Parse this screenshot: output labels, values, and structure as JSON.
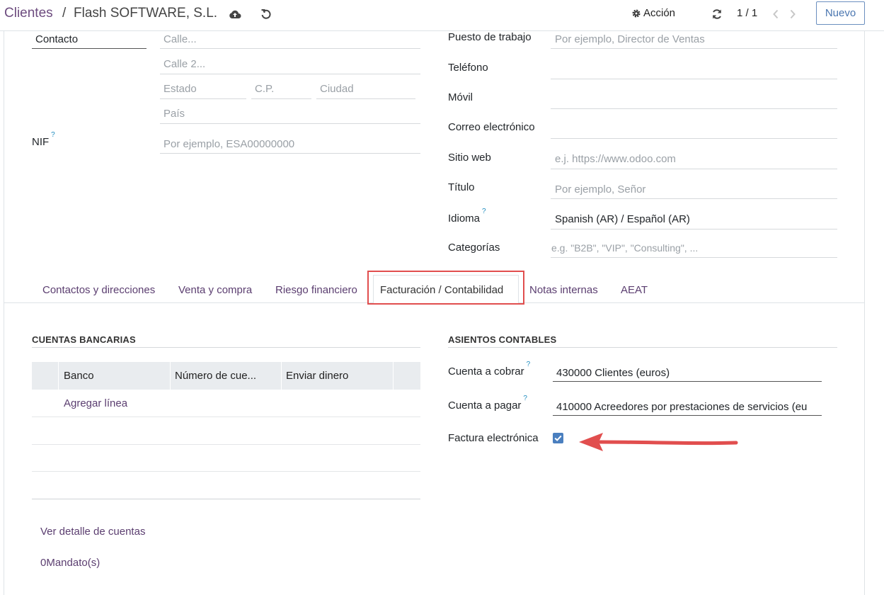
{
  "breadcrumb": {
    "root": "Clientes",
    "separator": "/",
    "current": "Flash SOFTWARE, S.L."
  },
  "toolbar": {
    "action_label": "Acción",
    "pager": "1 / 1",
    "new_label": "Nuevo"
  },
  "address": {
    "type_value": "Contacto",
    "street_placeholder": "Calle...",
    "street2_placeholder": "Calle 2...",
    "state_placeholder": "Estado",
    "zip_placeholder": "C.P.",
    "city_placeholder": "Ciudad",
    "country_placeholder": "País",
    "vat_label": "NIF",
    "vat_help": "?",
    "vat_placeholder": "Por ejemplo, ESA00000000"
  },
  "contact": {
    "job_label": "Puesto de trabajo",
    "job_placeholder": "Por ejemplo, Director de Ventas",
    "phone_label": "Teléfono",
    "mobile_label": "Móvil",
    "email_label": "Correo electrónico",
    "website_label": "Sitio web",
    "website_placeholder": "e.j. https://www.odoo.com",
    "title_label": "Título",
    "title_placeholder": "Por ejemplo, Señor",
    "lang_label": "Idioma",
    "lang_help": "?",
    "lang_value": "Spanish (AR) / Español (AR)",
    "tags_label": "Categorías",
    "tags_placeholder": "e.g. \"B2B\", \"VIP\", \"Consulting\", ..."
  },
  "tabs": [
    {
      "label": "Contactos y direcciones"
    },
    {
      "label": "Venta y compra"
    },
    {
      "label": "Riesgo financiero"
    },
    {
      "label": "Facturación / Contabilidad",
      "active": true
    },
    {
      "label": "Notas internas"
    },
    {
      "label": "AEAT"
    }
  ],
  "bank": {
    "title": "CUENTAS BANCARIAS",
    "columns": [
      "Banco",
      "Número de cue...",
      "Enviar dinero"
    ],
    "add_line": "Agregar línea",
    "details_link": "Ver detalle de cuentas",
    "mandates_link": "0Mandato(s)"
  },
  "accounting": {
    "title": "ASIENTOS CONTABLES",
    "receivable_label": "Cuenta a cobrar",
    "receivable_help": "?",
    "receivable_value": "430000 Clientes (euros)",
    "payable_label": "Cuenta a pagar",
    "payable_help": "?",
    "payable_value": "410000 Acreedores por prestaciones de servicios (eu",
    "einvoice_label": "Factura electrónica",
    "einvoice_checked": true
  },
  "colors": {
    "accent": "#5b3e70",
    "annotation": "#e14e4e",
    "checkbox": "#4a7fbf"
  }
}
